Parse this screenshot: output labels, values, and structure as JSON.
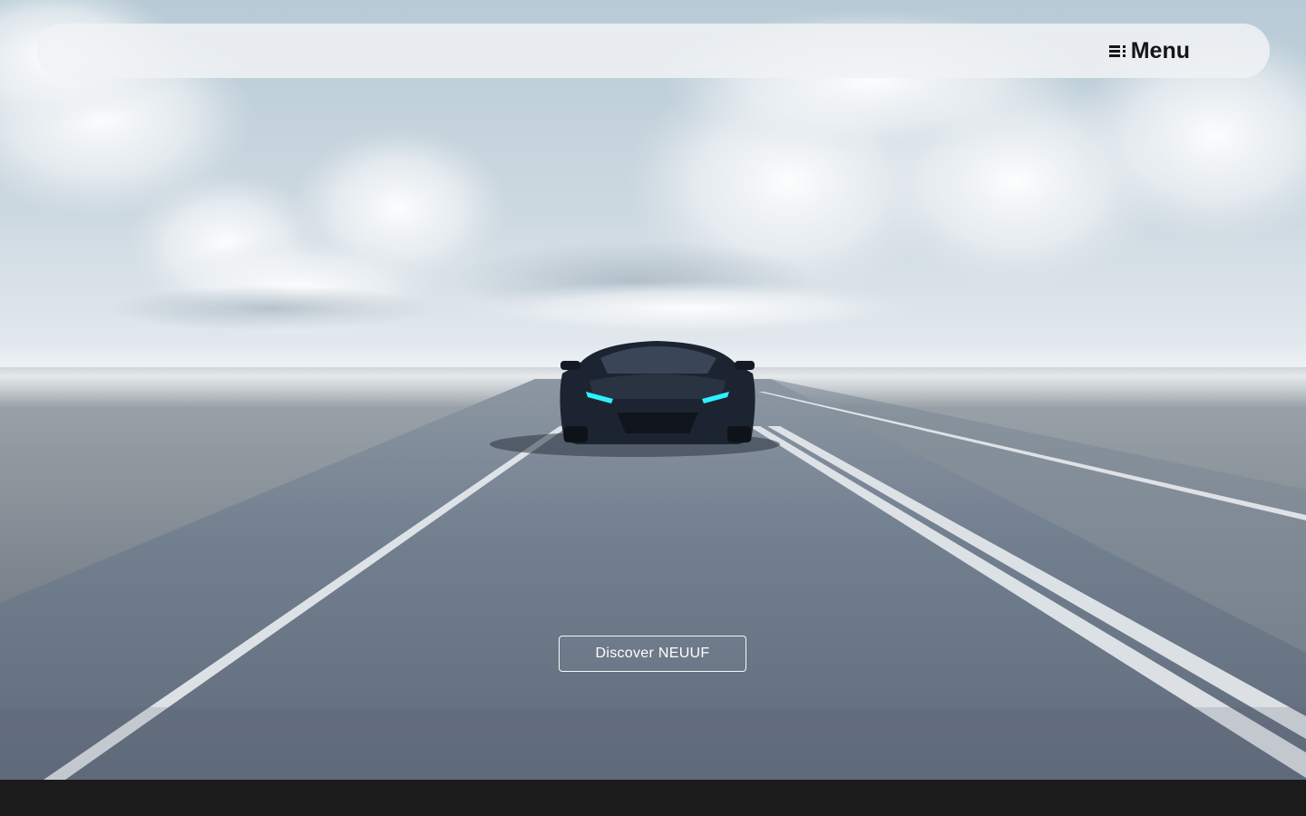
{
  "header": {
    "menu_label": "Menu",
    "menu_icon": "hamburger-menu-icon"
  },
  "hero": {
    "image_subject": "black sports car driving on open highway under cloudy sky",
    "cta_label": "Discover NEUUF"
  },
  "colors": {
    "sky_top": "#b9ccd6",
    "sky_horizon": "#e8eef2",
    "road": "#6b7a8c",
    "car_body": "#1c2431",
    "headlight": "#2ff0ff",
    "footer": "#1b1b1b"
  }
}
